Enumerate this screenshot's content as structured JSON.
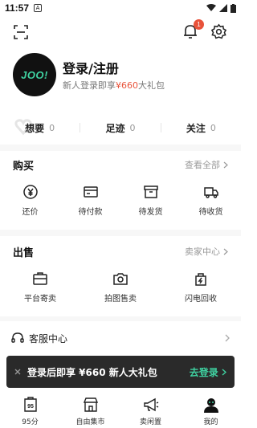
{
  "status_bar": {
    "time": "11:57",
    "notification_glyph": "A"
  },
  "header": {
    "bell_badge": "1"
  },
  "profile": {
    "avatar_text": "JOO!",
    "login_title": "登录/注册",
    "gift_prefix": "新人登录即享",
    "gift_amount": "¥660",
    "gift_suffix": "大礼包"
  },
  "stats": [
    {
      "label": "想要",
      "count": "0"
    },
    {
      "label": "足迹",
      "count": "0"
    },
    {
      "label": "关注",
      "count": "0"
    }
  ],
  "purchase": {
    "title": "购买",
    "more_label": "查看全部",
    "items": [
      {
        "icon": "yen-coin-icon",
        "label": "还价"
      },
      {
        "icon": "wallet-icon",
        "label": "待付款"
      },
      {
        "icon": "box-icon",
        "label": "待发货"
      },
      {
        "icon": "truck-icon",
        "label": "待收货"
      }
    ]
  },
  "sell": {
    "title": "出售",
    "more_label": "卖家中心",
    "items": [
      {
        "icon": "briefcase-icon",
        "label": "平台寄卖"
      },
      {
        "icon": "camera-icon",
        "label": "拍图售卖"
      },
      {
        "icon": "bag-icon",
        "label": "闪电回收"
      }
    ]
  },
  "service": {
    "label": "客服中心"
  },
  "banner": {
    "message": "登录后即享 ¥660 新人大礼包",
    "cta": "去登录"
  },
  "tabbar": [
    {
      "icon": "95-icon",
      "glyph": "95",
      "label": "95分"
    },
    {
      "icon": "market-icon",
      "label": "自由集市"
    },
    {
      "icon": "megaphone-icon",
      "label": "卖闲置"
    },
    {
      "icon": "profile-icon",
      "label": "我的"
    }
  ],
  "colors": {
    "accent": "#3fd2a1",
    "price": "#e8523a",
    "banner_bg": "#2a2a2a"
  }
}
